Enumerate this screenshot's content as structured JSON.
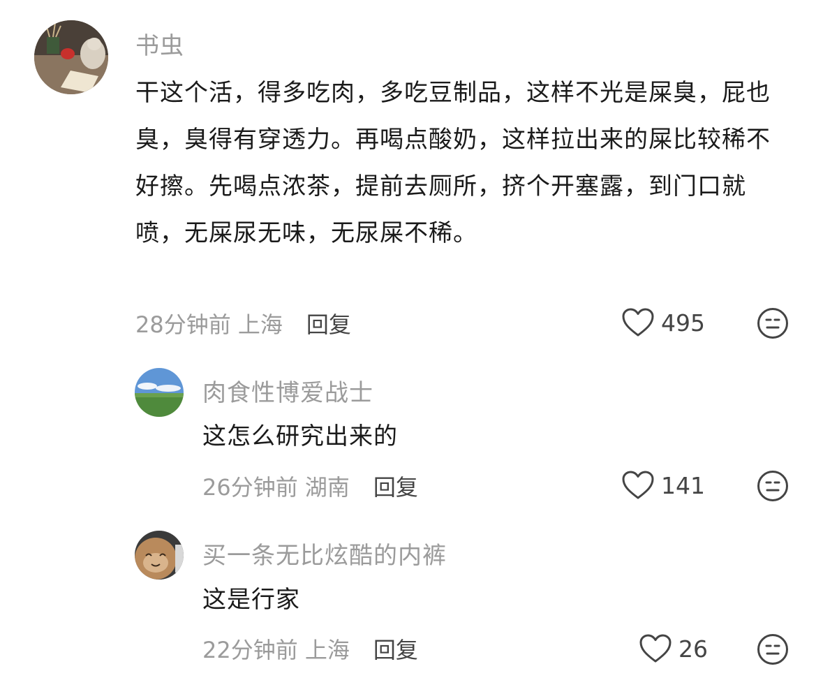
{
  "comments": [
    {
      "username": "书虫",
      "avatar": "cat-desk-avatar",
      "text": "干这个活，得多吃肉，多吃豆制品，这样不光是屎臭，屁也臭，臭得有穿透力。再喝点酸奶，这样拉出来的屎比较稀不好擦。先喝点浓茶，提前去厕所，挤个开塞露，到门口就喷，无屎尿无味，无尿屎不稀。",
      "time": "28分钟前",
      "location": "上海",
      "reply_label": "回复",
      "likes": "495"
    },
    {
      "username": "肉食性博爱战士",
      "avatar": "grassland-sky-avatar",
      "text": "这怎么研究出来的",
      "time": "26分钟前",
      "location": "湖南",
      "reply_label": "回复",
      "likes": "141"
    },
    {
      "username": "买一条无比炫酷的内裤",
      "avatar": "smiling-cat-avatar",
      "text": "这是行家",
      "time": "22分钟前",
      "location": "上海",
      "reply_label": "回复",
      "likes": "26"
    }
  ],
  "icons": {
    "like": "heart-outline-icon",
    "dislike": "neutral-face-icon"
  },
  "colors": {
    "username": "#9b9b9b",
    "text": "#1a1a1a",
    "meta": "#9b9b9b",
    "icon": "#444444"
  }
}
